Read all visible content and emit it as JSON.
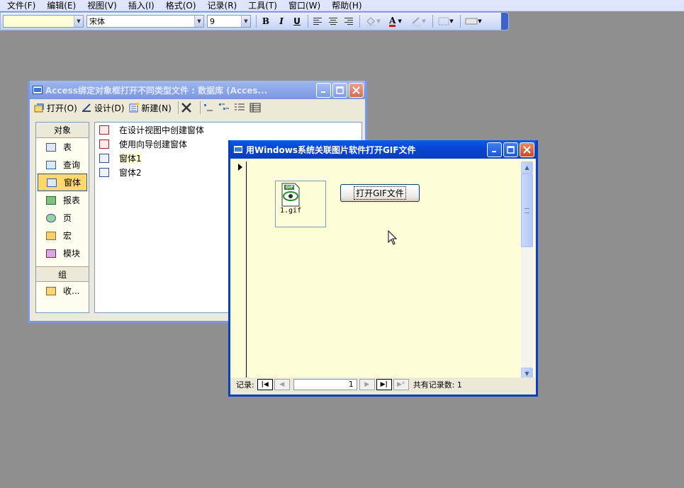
{
  "menu": [
    "文件(F)",
    "编辑(E)",
    "视图(V)",
    "插入(I)",
    "格式(O)",
    "记录(R)",
    "工具(T)",
    "窗口(W)",
    "帮助(H)"
  ],
  "format_toolbar": {
    "object_combo": "",
    "font_combo": "宋体",
    "size_combo": "9",
    "bold": "B",
    "italic": "I",
    "underline": "U",
    "font_color_glyph": "A"
  },
  "db_window": {
    "title": "Access绑定对象框打开不同类型文件 : 数据库 (Acces...",
    "toolbar": {
      "open": "打开(O)",
      "design": "设计(D)",
      "new": "新建(N)"
    },
    "objects_header": "对象",
    "objects": [
      {
        "label": "表",
        "icon": "table-icon"
      },
      {
        "label": "查询",
        "icon": "query-icon"
      },
      {
        "label": "窗体",
        "icon": "form-icon",
        "selected": true
      },
      {
        "label": "报表",
        "icon": "report-icon"
      },
      {
        "label": "页",
        "icon": "page-icon"
      },
      {
        "label": "宏",
        "icon": "macro-icon"
      },
      {
        "label": "模块",
        "icon": "module-icon"
      }
    ],
    "groups_header": "组",
    "groups": [
      {
        "label": "收...",
        "icon": "favorites-icon"
      }
    ],
    "items": [
      {
        "label": "在设计视图中创建窗体",
        "icon": "wizard-icon"
      },
      {
        "label": "使用向导创建窗体",
        "icon": "wizard-icon"
      },
      {
        "label": "窗体1",
        "icon": "form-icon"
      },
      {
        "label": "窗体2",
        "icon": "form-icon"
      }
    ]
  },
  "form_window": {
    "title": "用Windows系统关联图片软件打开GIF文件",
    "gif_caption": "1.gif",
    "gif_badge": "GIF",
    "open_button": "打开GIF文件",
    "nav": {
      "record_label": "记录:",
      "current": "1",
      "total_label": "共有记录数: 1"
    }
  },
  "colors": {
    "active_title": "#0a3fc0",
    "inactive_title": "#7a96df",
    "form_background": "#fdfdd8",
    "desktop": "#8f8f8f"
  }
}
